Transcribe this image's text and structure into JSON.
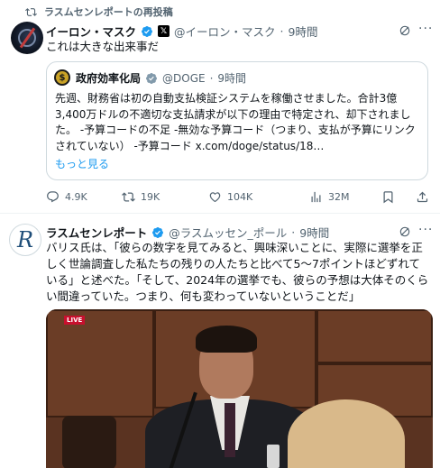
{
  "repost": {
    "label": "ラスムセンレポートの再投稿"
  },
  "tweet1": {
    "author_name": "イーロン・マスク",
    "x_badge": "𝕏",
    "handle": "@イーロン・マスク",
    "time": "9時間",
    "text": "これは大きな出来事だ",
    "quote": {
      "avatar_glyph": "$",
      "author_name": "政府効率化局",
      "handle": "@DOGE",
      "time": "9時間",
      "text": "先週、財務省は初の自動支払検証システムを稼働させました。合計3億3,400万ドルの不適切な支払請求が以下の理由で特定され、却下されました。 -予算コードの不足 -無効な予算コード（つまり、支払が予算にリンクされていない） -予算コード x.com/doge/status/18…",
      "more": "もっと見る"
    },
    "actions": {
      "replies": "4.9K",
      "reposts": "19K",
      "likes": "104K",
      "views": "32M"
    }
  },
  "tweet2": {
    "avatar_glyph": "R",
    "author_name": "ラスムセンレポート",
    "handle": "@ラスムッセン_ポール",
    "time": "9時間",
    "text": "バリス氏は、「彼らの数字を見てみると、興味深いことに、実際に選挙を正しく世論調査した私たちの残りの人たちと比べて5～7ポイントほどずれている」と述べた。「そして、2024年の選挙でも、彼らの予想は大体そのくらい間違っていた。つまり、何も変わっていないということだ」",
    "media_badge": "LIVE"
  },
  "colors": {
    "accent": "#1d9bf0",
    "muted": "#536471",
    "border": "#cfd9de"
  },
  "icons": [
    "repost-icon",
    "verified-badge-icon",
    "grok-icon",
    "more-icon",
    "reply-icon",
    "like-icon",
    "views-icon",
    "bookmark-icon",
    "share-icon"
  ]
}
